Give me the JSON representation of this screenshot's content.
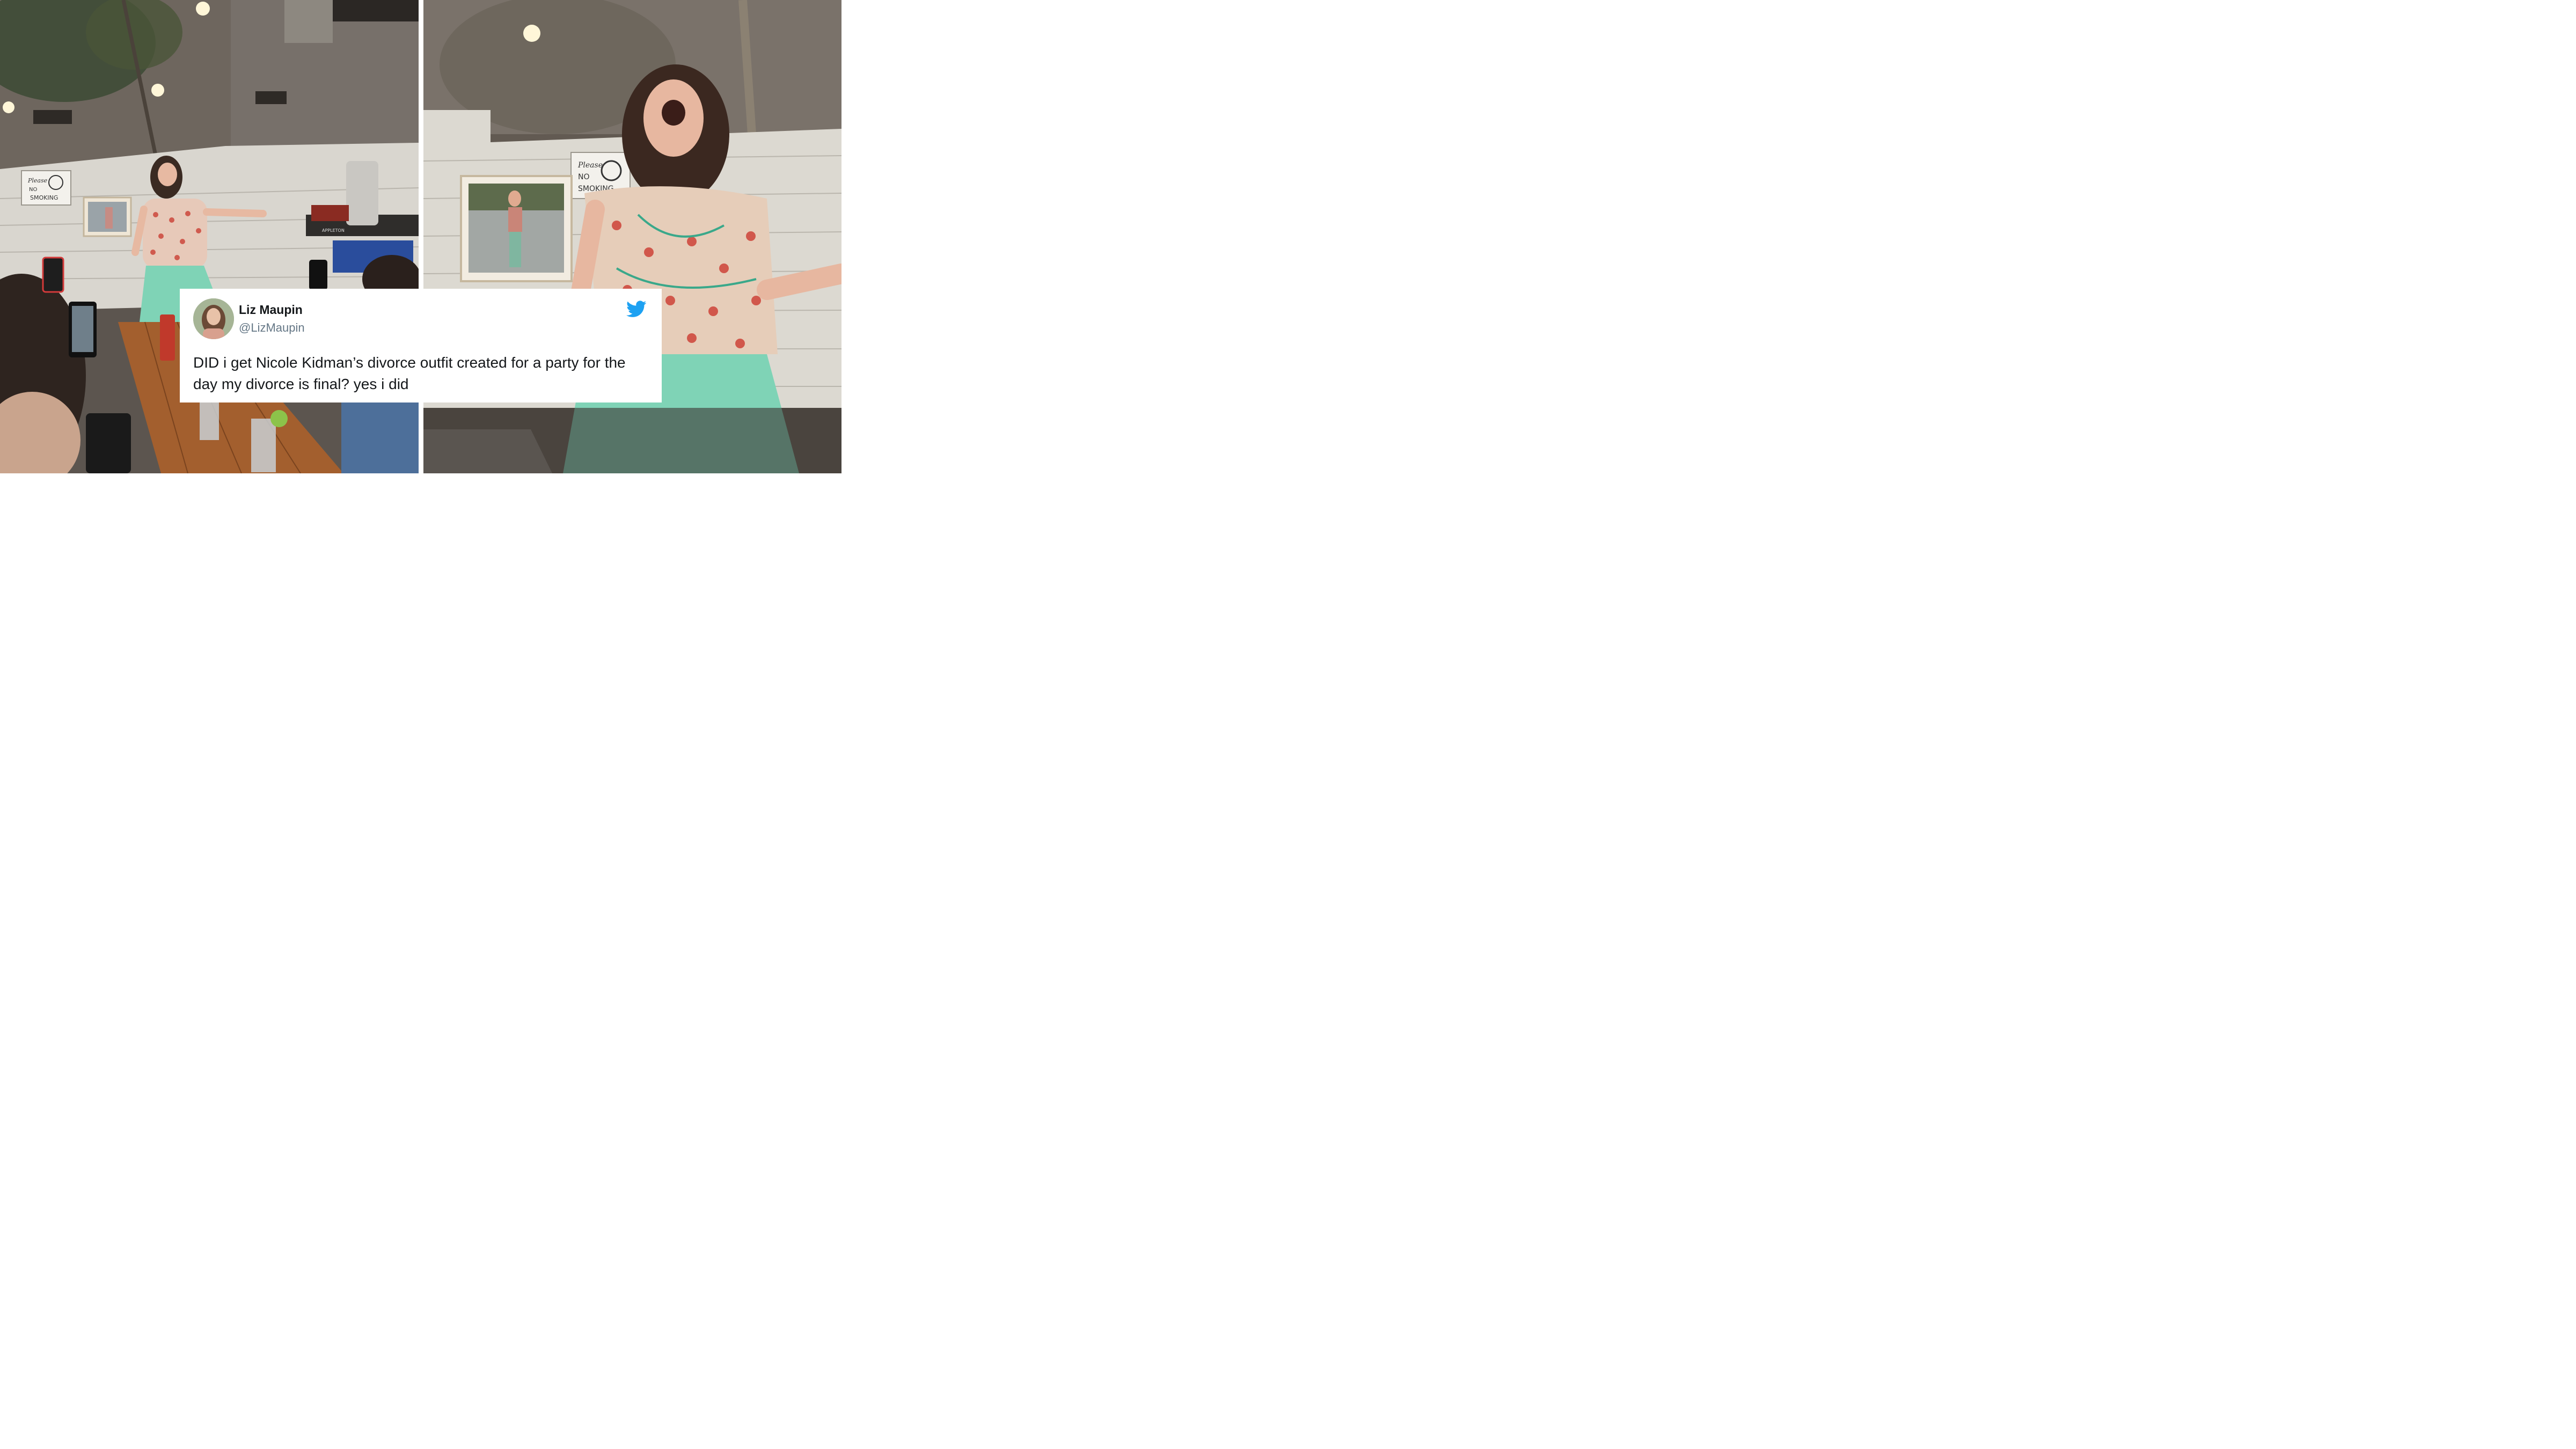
{
  "tweet": {
    "display_name": "Liz Maupin",
    "handle": "@LizMaupin",
    "text": "DID i get Nicole Kidman’s divorce outfit created for a party for the day my divorce is final? yes i did",
    "brand_icon": "twitter-bird-icon",
    "brand_color": "#1DA1F2"
  },
  "photos": {
    "left": {
      "sign_line1": "Please",
      "sign_line2": "NO",
      "sign_line3": "SMOKING",
      "jug_label": "APPLETON"
    },
    "right": {
      "sign_line1": "Please",
      "sign_line2": "NO",
      "sign_line3": "SMOKING"
    }
  }
}
